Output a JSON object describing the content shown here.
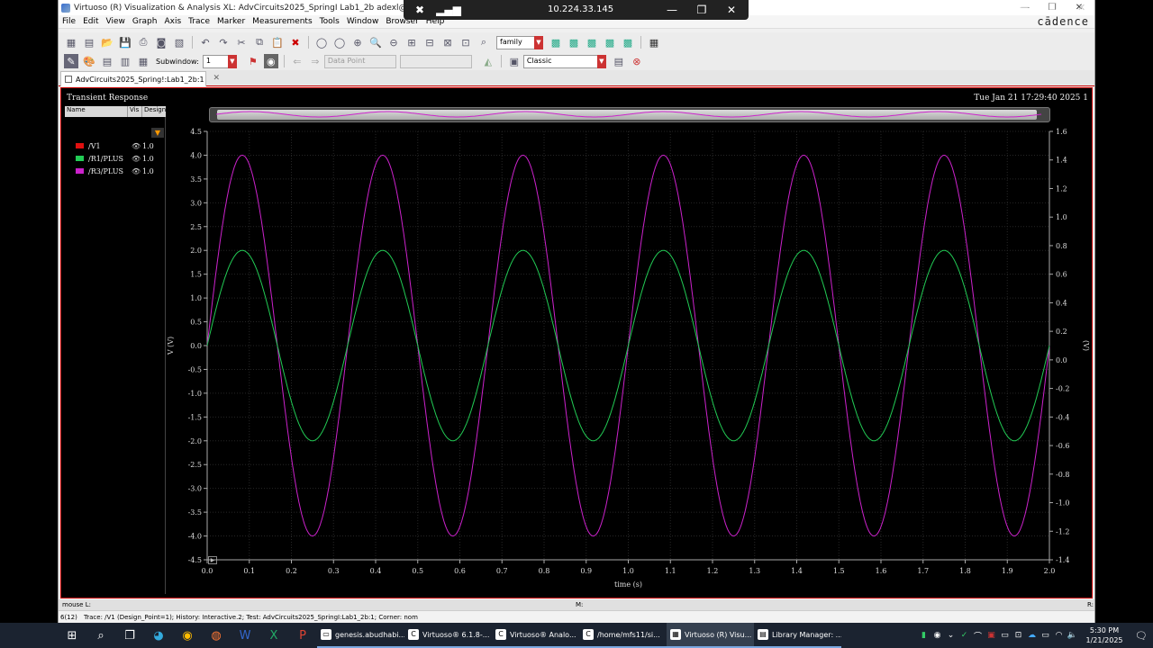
{
  "window": {
    "title": "Virtuoso (R) Visualization & Analysis XL: AdvCircuits2025_SpringI Lab1_2b adexl@aduae251-lap.abudhabi",
    "brand": "cādence"
  },
  "rdp": {
    "ip": "10.224.33.145"
  },
  "menu": [
    "File",
    "Edit",
    "View",
    "Graph",
    "Axis",
    "Trace",
    "Marker",
    "Measurements",
    "Tools",
    "Window",
    "Browser",
    "Help"
  ],
  "toolbar1": {
    "family_value": "family"
  },
  "toolbar2": {
    "subwindow_label": "Subwindow:",
    "subwindow_value": "1",
    "datapoint_placeholder": "Data Point",
    "style_value": "Classic"
  },
  "tab": {
    "label": "AdvCircuits2025_Spring!:Lab1_2b:1"
  },
  "graph": {
    "title": "Transient Response",
    "timestamp": "Tue Jan 21 17:29:40 2025  1"
  },
  "legend": {
    "headers": [
      "Name",
      "Vis",
      "Design"
    ],
    "items": [
      {
        "name": "/V1",
        "vis": "1.0",
        "color": "#e01010"
      },
      {
        "name": "/R1/PLUS",
        "vis": "1.0",
        "color": "#22cc55"
      },
      {
        "name": "/R3/PLUS",
        "vis": "1.0",
        "color": "#cc22cc"
      }
    ]
  },
  "chart_data": {
    "type": "line",
    "xlabel": "time (s)",
    "ylabel": "V (V)",
    "y2label": "(V)",
    "xlim": [
      0.0,
      2.0
    ],
    "ylim": [
      -4.5,
      4.5
    ],
    "y2lim": [
      -1.4,
      1.6
    ],
    "xticks": [
      "0.0",
      "0.1",
      "0.2",
      "0.3",
      "0.4",
      "0.5",
      "0.6",
      "0.7",
      "0.8",
      "0.9",
      "1.0",
      "1.1",
      "1.2",
      "1.3",
      "1.4",
      "1.5",
      "1.6",
      "1.7",
      "1.8",
      "1.9",
      "2.0"
    ],
    "yticks": [
      "4.5",
      "4.0",
      "3.5",
      "3.0",
      "2.5",
      "2.0",
      "1.5",
      "1.0",
      "0.5",
      "0.0",
      "-0.5",
      "-1.0",
      "-1.5",
      "-2.0",
      "-2.5",
      "-3.0",
      "-3.5",
      "-4.0",
      "-4.5"
    ],
    "y2ticks": [
      "1.6",
      "1.4",
      "1.2",
      "1.0",
      "0.8",
      "0.6",
      "0.4",
      "0.2",
      "0.0",
      "-0.2",
      "-0.4",
      "-0.6",
      "-0.8",
      "-1.0",
      "-1.2",
      "-1.4"
    ],
    "grid": true,
    "series": [
      {
        "name": "/R3/PLUS",
        "color": "#cc22cc",
        "amplitude": 4.0,
        "frequency": 3.0,
        "axis": "left"
      },
      {
        "name": "/R1/PLUS",
        "color": "#22cc55",
        "amplitude": 2.0,
        "frequency": 3.0,
        "axis": "left"
      }
    ]
  },
  "status": {
    "mouse": "mouse L:",
    "mid": "M:",
    "right": "R:"
  },
  "info": {
    "count": "6(12)",
    "text": "Trace: /V1 (Design_Point=1); History: Interactive.2; Test: AdvCircuits2025_SpringI:Lab1_2b:1; Corner: nom"
  },
  "taskbar": {
    "apps": [
      {
        "label": "genesis.abudhabi...",
        "icon": "genesis-icon"
      },
      {
        "label": "Virtuoso® 6.1.8-...",
        "icon": "cadence-icon"
      },
      {
        "label": "Virtuoso® Analo...",
        "icon": "cadence-icon"
      },
      {
        "label": "/home/mfs11/si...",
        "icon": "cadence-icon"
      },
      {
        "label": "Virtuoso (R) Visu...",
        "icon": "viva-icon"
      },
      {
        "label": "Library Manager: ...",
        "icon": "library-icon"
      }
    ],
    "time": "5:30 PM",
    "date": "1/21/2025"
  }
}
